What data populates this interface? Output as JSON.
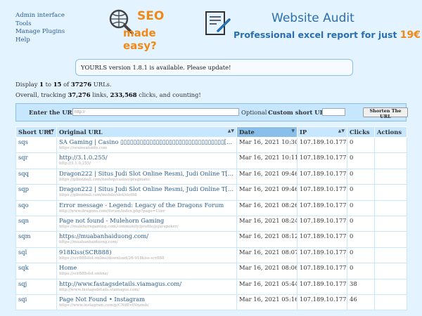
{
  "nav": [
    {
      "label": "Admin interface"
    },
    {
      "label": "Tools"
    },
    {
      "label": "Manage Plugins"
    },
    {
      "label": "Help"
    }
  ],
  "ads": {
    "seo_word": "SEO",
    "seo_tagline": "made easy?",
    "audit_title": "Website Audit",
    "audit_subtitle": "Professional excel report for just",
    "audit_price": "19€"
  },
  "notice": "YOURLS version 1.8.1 is available. Please update!",
  "display": {
    "pre": "Display",
    "from": "1",
    "to_word": "to",
    "to": "15",
    "of_word": "of",
    "total": "37276",
    "post": "URLs."
  },
  "tracking": {
    "pre": "Overall, tracking",
    "links": "37,276",
    "links_word": "links,",
    "clicks": "233,568",
    "post": "clicks, and counting!"
  },
  "form": {
    "url_label": "Enter the URL:",
    "url_value": "http://",
    "optional_label": "Optional :",
    "custom_label": "Custom short URL:",
    "custom_value": "",
    "submit_label": "Shorten The URL"
  },
  "table": {
    "headers": {
      "short": "Short URL",
      "original": "Original URL",
      "date": "Date",
      "ip": "IP",
      "clicks": "Clicks",
      "actions": "Actions"
    },
    "rows": [
      {
        "short": "sqs",
        "title": "SA Gaming | Casino ▯▯▯▯▯▯▯▯▯▯▯▯▯▯▯▯▯▯▯▯▯▯▯▯▯▯▯▯▯▯▯▯[…]",
        "url": "https://sexmeaninfo.com",
        "date": "Mar 16, 2021 10:30",
        "ip": "107.189.10.177",
        "clicks": "0"
      },
      {
        "short": "sqr",
        "title": "http://3.1.0.255/",
        "url": "http://3.1.0.255/",
        "date": "Mar 16, 2021 10:11",
        "ip": "107.189.10.177",
        "clicks": "0"
      },
      {
        "short": "sqq",
        "title": "Dragon222 | Situs Judi Slot Online Resmi, Judi Online T[…]",
        "url": "https://gibonball.com/nostop/casino/pragmatic",
        "date": "Mar 16, 2021 09:46",
        "ip": "107.189.10.177",
        "clicks": "0"
      },
      {
        "short": "sqp",
        "title": "Dragon222 | Situs Judi Slot Online Resmi, Judi Online T[…]",
        "url": "https://gibonball.com/mobile/slot/slot88",
        "date": "Mar 16, 2021 09:46",
        "ip": "107.189.10.177",
        "clicks": "0"
      },
      {
        "short": "sqo",
        "title": "Error message - Legend: Legacy of the Dragons Forum",
        "url": "http://www.dragons.com/forum/index.php?page=User",
        "date": "Mar 16, 2021 08:26",
        "ip": "107.189.10.177",
        "clicks": "0"
      },
      {
        "short": "sqn",
        "title": "Page not found - Mulehorn Gaming",
        "url": "https://mulehorngaming.com/community/profile/jejurapoker/",
        "date": "Mar 16, 2021 08:24",
        "ip": "107.189.10.177",
        "clicks": "0"
      },
      {
        "short": "sqm",
        "title": "https://muabanhaiduong.com/",
        "url": "https://muabanhaiduong.com/",
        "date": "Mar 16, 2021 08:12",
        "ip": "107.189.10.177",
        "clicks": "0"
      },
      {
        "short": "sql",
        "title": "918Kiss(SCR888)",
        "url": "https://scr888slot.online/download/26-918kiss-scr888",
        "date": "Mar 16, 2021 08:07",
        "ip": "107.189.10.177",
        "clicks": "0"
      },
      {
        "short": "sqk",
        "title": "Home",
        "url": "https://scr888slot.online/",
        "date": "Mar 16, 2021 08:06",
        "ip": "107.189.10.177",
        "clicks": "0"
      },
      {
        "short": "sqj",
        "title": "http://www.fastagsdetails.viamagus.com/",
        "url": "http://www.fastagsdetails.viamagus.com/",
        "date": "Mar 16, 2021 05:44",
        "ip": "107.189.10.177",
        "clicks": "38"
      },
      {
        "short": "sqi",
        "title": "Page Not Found • Instagram",
        "url": "https://www.instagram.com/p/CNdEvtNnzmb/",
        "date": "Mar 16, 2021 05:16",
        "ip": "107.189.10.177",
        "clicks": "46"
      }
    ]
  }
}
